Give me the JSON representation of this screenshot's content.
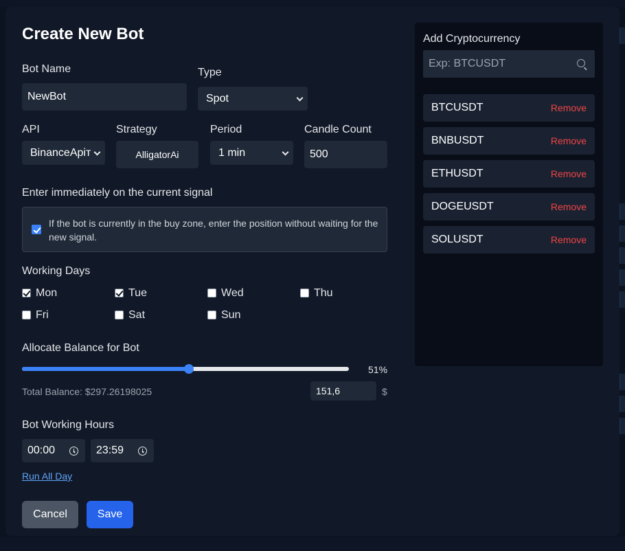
{
  "modal": {
    "title": "Create New Bot",
    "bot_name": {
      "label": "Bot Name",
      "value": "NewBot"
    },
    "type": {
      "label": "Type",
      "value": "Spot"
    },
    "api": {
      "label": "API",
      "value": "BinanceApiт"
    },
    "strategy": {
      "label": "Strategy",
      "value": "AlligatorAi"
    },
    "period": {
      "label": "Period",
      "value": "1 min"
    },
    "candle_count": {
      "label": "Candle Count",
      "value": "500"
    },
    "immediate": {
      "heading": "Enter immediately on the current signal",
      "text": "If the bot is currently in the buy zone, enter the position without waiting for the new signal.",
      "checked": true
    },
    "working_days": {
      "heading": "Working Days",
      "days": [
        {
          "label": "Mon",
          "checked": true
        },
        {
          "label": "Tue",
          "checked": true
        },
        {
          "label": "Wed",
          "checked": false
        },
        {
          "label": "Thu",
          "checked": false
        },
        {
          "label": "Fri",
          "checked": false
        },
        {
          "label": "Sat",
          "checked": false
        },
        {
          "label": "Sun",
          "checked": false
        }
      ]
    },
    "allocate": {
      "heading": "Allocate Balance for Bot",
      "percent_value": 51,
      "percent_label": "51%",
      "total_balance": "Total Balance: $297.26198025",
      "amount": "151,6",
      "currency": "$"
    },
    "hours": {
      "heading": "Bot Working Hours",
      "start": "00:00",
      "end": "23:59",
      "run_all_day": "Run All Day"
    },
    "buttons": {
      "cancel": "Cancel",
      "save": "Save"
    }
  },
  "crypto_panel": {
    "title": "Add Cryptocurrency",
    "search_placeholder": "Exp: BTCUSDT",
    "remove_label": "Remove",
    "coins": [
      "BTCUSDT",
      "BNBUSDT",
      "ETHUSDT",
      "DOGEUSDT",
      "SOLUSDT"
    ]
  },
  "colors": {
    "accent": "#2563eb",
    "danger": "#ef4444",
    "modal_bg": "#111827",
    "field_bg": "#1f2937"
  }
}
